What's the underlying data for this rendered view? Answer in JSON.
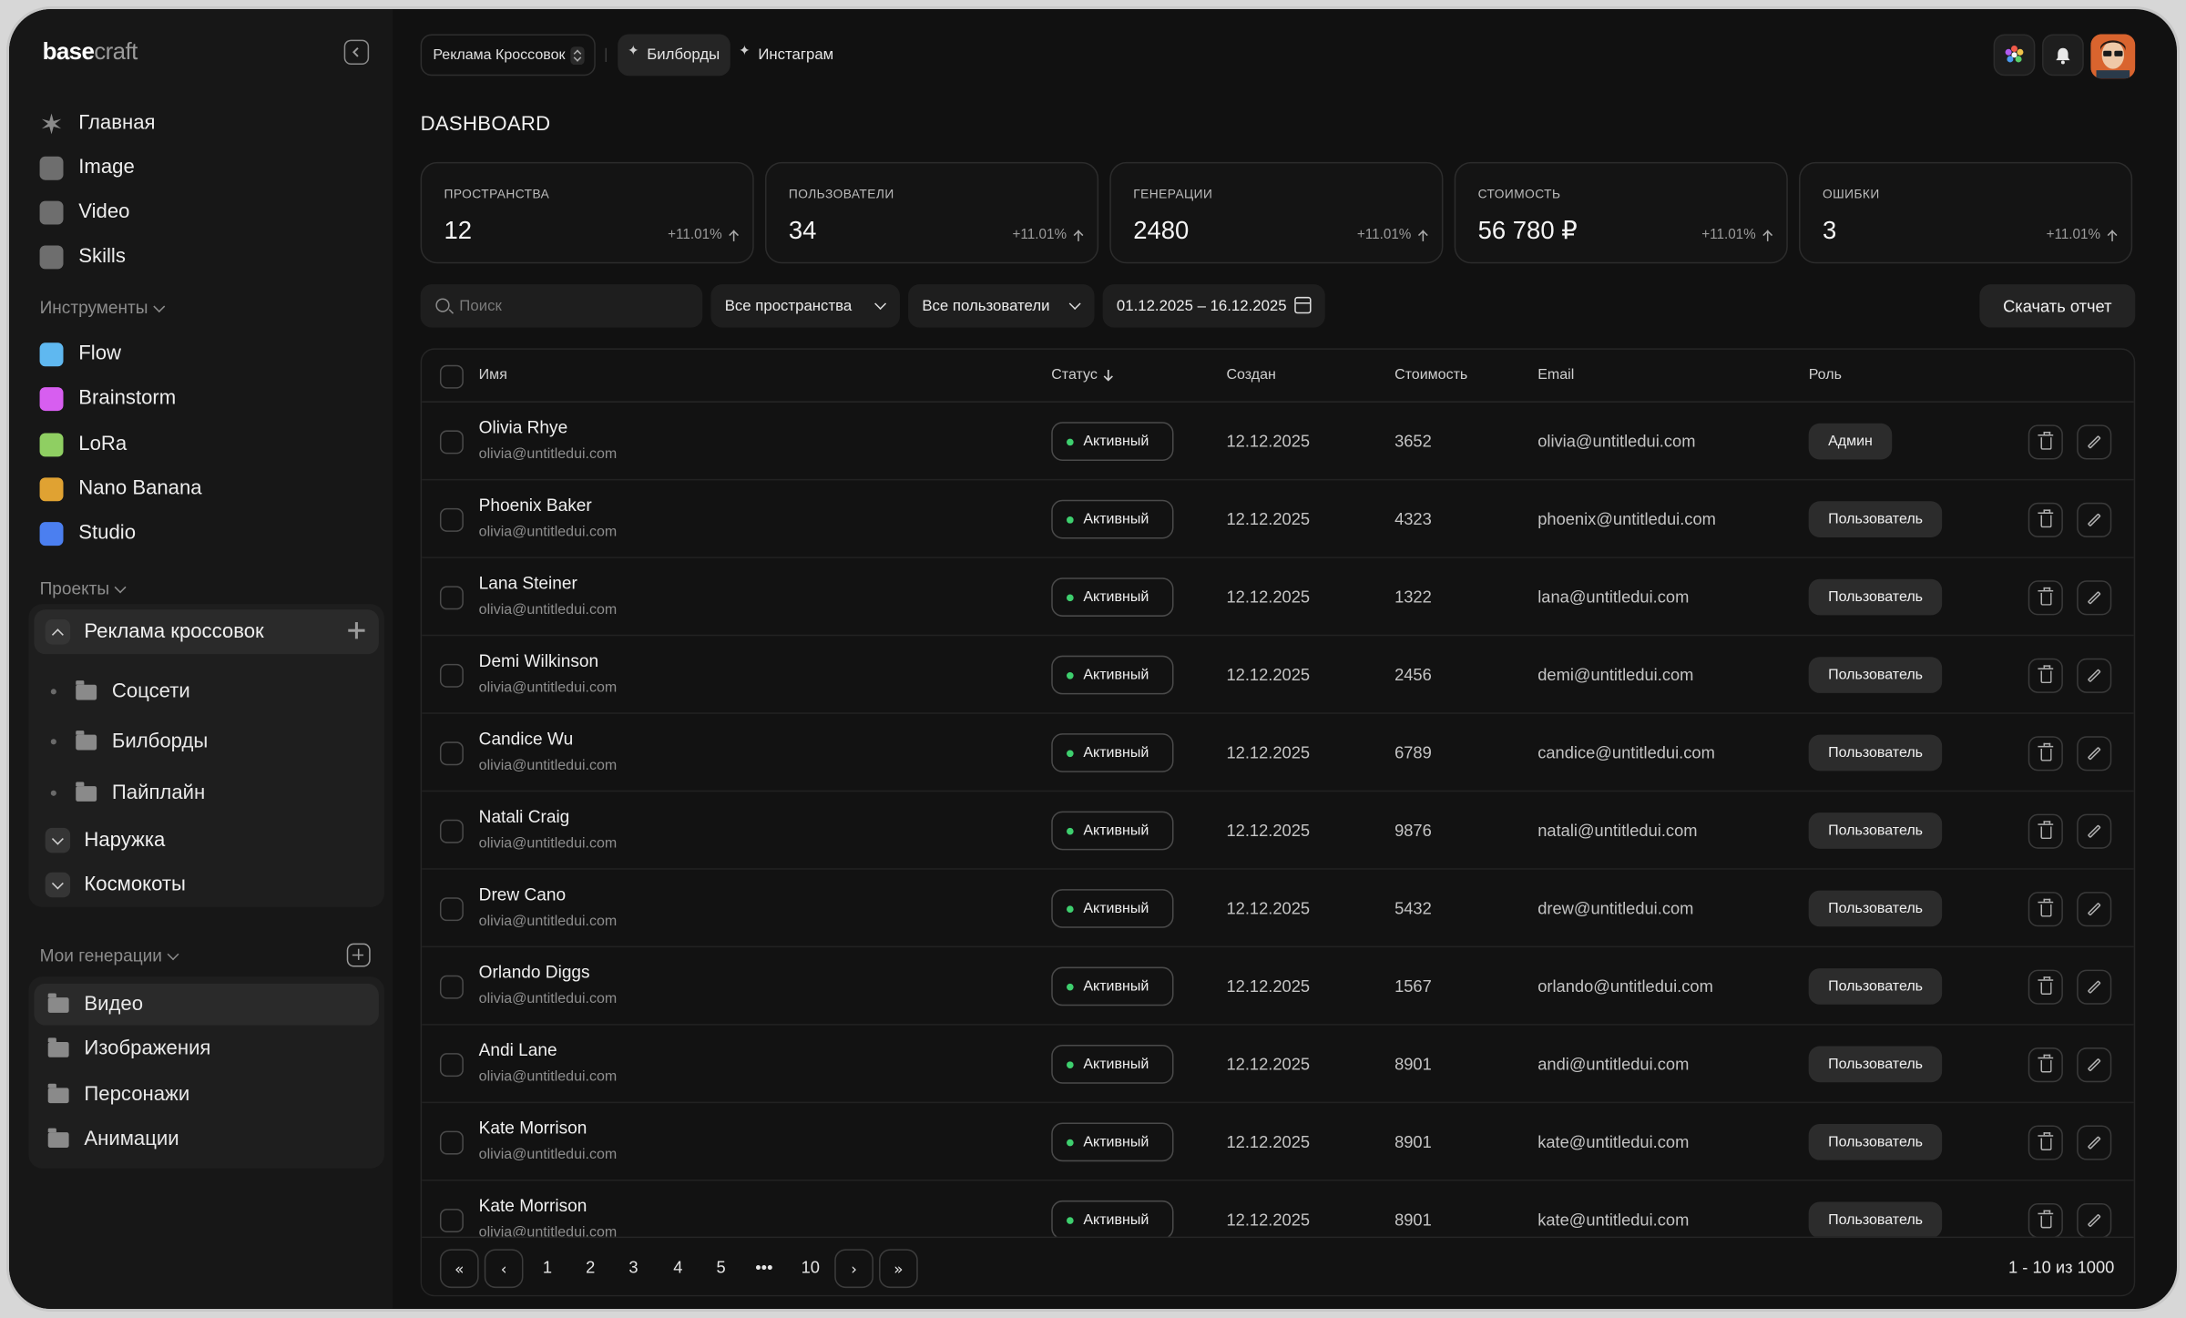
{
  "logo": {
    "bold": "base",
    "light": "craft"
  },
  "sidebar": {
    "main_items": [
      {
        "label": "Главная",
        "icon": "sparkle-icon",
        "color": "#8a8a8a"
      },
      {
        "label": "Image",
        "icon": "image-icon",
        "color": "#6e6e6e"
      },
      {
        "label": "Video",
        "icon": "video-icon",
        "color": "#6e6e6e"
      },
      {
        "label": "Skills",
        "icon": "grid-icon",
        "color": "#6e6e6e"
      }
    ],
    "tools_label": "Инструменты",
    "tools": [
      {
        "label": "Flow",
        "icon": "flow-icon",
        "color": "#5fb8f0"
      },
      {
        "label": "Brainstorm",
        "icon": "brainstorm-icon",
        "color": "#d75ef0"
      },
      {
        "label": "LoRa",
        "icon": "lora-icon",
        "color": "#8fcf62"
      },
      {
        "label": "Nano Banana",
        "icon": "banana-icon",
        "color": "#e0a232"
      },
      {
        "label": "Studio",
        "icon": "studio-icon",
        "color": "#4b7ff0"
      }
    ],
    "projects_label": "Проекты",
    "project_open": {
      "label": "Реклама кроссовок",
      "children": [
        "Соцсети",
        "Билборды",
        "Пайплайн"
      ]
    },
    "projects_collapsed": [
      "Наружка",
      "Космокоты"
    ],
    "generations_label": "Мои генерации",
    "generations": [
      "Видео",
      "Изображения",
      "Персонажи",
      "Анимации"
    ]
  },
  "topbar": {
    "workspace": "Реклама Кроссовок",
    "tabs": [
      "Билборды",
      "Инстаграм"
    ]
  },
  "page_title": "DASHBOARD",
  "stats": [
    {
      "label": "ПРОСТРАНСТВА",
      "value": "12",
      "delta": "+11.01%"
    },
    {
      "label": "ПОЛЬЗОВАТЕЛИ",
      "value": "34",
      "delta": "+11.01%"
    },
    {
      "label": "ГЕНЕРАЦИИ",
      "value": "2480",
      "delta": "+11.01%"
    },
    {
      "label": "СТОИМОСТЬ",
      "value": "56 780 ₽",
      "delta": "+11.01%"
    },
    {
      "label": "ОШИБКИ",
      "value": "3",
      "delta": "+11.01%"
    }
  ],
  "filters": {
    "search_placeholder": "Поиск",
    "spaces": "Все пространства",
    "users": "Все пользователи",
    "date_range": "01.12.2025 – 16.12.2025",
    "download": "Скачать отчет"
  },
  "table": {
    "headers": {
      "name": "Имя",
      "status": "Статус",
      "created": "Создан",
      "cost": "Стоимость",
      "email": "Email",
      "role": "Роль"
    },
    "rows": [
      {
        "name": "Olivia Rhye",
        "sub": "olivia@untitledui.com",
        "status": "Активный",
        "created": "12.12.2025",
        "cost": "3652",
        "email": "olivia@untitledui.com",
        "role": "Админ"
      },
      {
        "name": "Phoenix Baker",
        "sub": "olivia@untitledui.com",
        "status": "Активный",
        "created": "12.12.2025",
        "cost": "4323",
        "email": "phoenix@untitledui.com",
        "role": "Пользователь"
      },
      {
        "name": "Lana Steiner",
        "sub": "olivia@untitledui.com",
        "status": "Активный",
        "created": "12.12.2025",
        "cost": "1322",
        "email": "lana@untitledui.com",
        "role": "Пользователь"
      },
      {
        "name": "Demi Wilkinson",
        "sub": "olivia@untitledui.com",
        "status": "Активный",
        "created": "12.12.2025",
        "cost": "2456",
        "email": "demi@untitledui.com",
        "role": "Пользователь"
      },
      {
        "name": "Candice Wu",
        "sub": "olivia@untitledui.com",
        "status": "Активный",
        "created": "12.12.2025",
        "cost": "6789",
        "email": "candice@untitledui.com",
        "role": "Пользователь"
      },
      {
        "name": "Natali Craig",
        "sub": "olivia@untitledui.com",
        "status": "Активный",
        "created": "12.12.2025",
        "cost": "9876",
        "email": "natali@untitledui.com",
        "role": "Пользователь"
      },
      {
        "name": "Drew Cano",
        "sub": "olivia@untitledui.com",
        "status": "Активный",
        "created": "12.12.2025",
        "cost": "5432",
        "email": "drew@untitledui.com",
        "role": "Пользователь"
      },
      {
        "name": "Orlando Diggs",
        "sub": "olivia@untitledui.com",
        "status": "Активный",
        "created": "12.12.2025",
        "cost": "1567",
        "email": "orlando@untitledui.com",
        "role": "Пользователь"
      },
      {
        "name": "Andi Lane",
        "sub": "olivia@untitledui.com",
        "status": "Активный",
        "created": "12.12.2025",
        "cost": "8901",
        "email": "andi@untitledui.com",
        "role": "Пользователь"
      },
      {
        "name": "Kate Morrison",
        "sub": "olivia@untitledui.com",
        "status": "Активный",
        "created": "12.12.2025",
        "cost": "8901",
        "email": "kate@untitledui.com",
        "role": "Пользователь"
      },
      {
        "name": "Kate Morrison",
        "sub": "olivia@untitledui.com",
        "status": "Активный",
        "created": "12.12.2025",
        "cost": "8901",
        "email": "kate@untitledui.com",
        "role": "Пользователь"
      }
    ]
  },
  "pagination": {
    "first": "«",
    "prev": "‹",
    "next": "›",
    "last": "»",
    "pages": [
      "1",
      "2",
      "3",
      "4",
      "5",
      "•••",
      "10"
    ],
    "info": "1 - 10 из 1000"
  },
  "colors": {
    "status_active": "#3ecf6e",
    "background": "#111111",
    "sidebar": "#171717"
  }
}
